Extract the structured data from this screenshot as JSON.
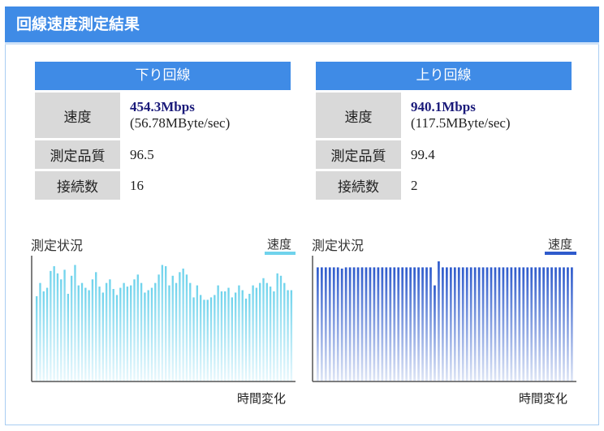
{
  "window": {
    "title": "回線速度測定結果"
  },
  "download": {
    "header": "下り回線",
    "speed_label": "速度",
    "speed_value": "454.3Mbps",
    "speed_bytes": "(56.78MByte/sec)",
    "quality_label": "測定品質",
    "quality_value": "96.5",
    "connections_label": "接続数",
    "connections_value": "16"
  },
  "upload": {
    "header": "上り回線",
    "speed_label": "速度",
    "speed_value": "940.1Mbps",
    "speed_bytes": "(117.5MByte/sec)",
    "quality_label": "測定品質",
    "quality_value": "99.4",
    "connections_label": "接続数",
    "connections_value": "2"
  },
  "chart_data": [
    {
      "type": "bar",
      "title": "測定状況",
      "legend": "速度",
      "xlabel": "時間変化",
      "color": "#6fd3ec",
      "fade_color": "#e9f8fd",
      "ylim": [
        0,
        1
      ],
      "values": [
        0.71,
        0.82,
        0.75,
        0.78,
        0.92,
        0.96,
        0.9,
        0.85,
        0.93,
        0.73,
        0.88,
        0.97,
        0.8,
        0.82,
        0.78,
        0.76,
        0.85,
        0.91,
        0.79,
        0.74,
        0.82,
        0.85,
        0.77,
        0.72,
        0.78,
        0.82,
        0.79,
        0.8,
        0.85,
        0.89,
        0.82,
        0.74,
        0.76,
        0.78,
        0.82,
        0.89,
        0.97,
        0.96,
        0.8,
        0.88,
        0.82,
        0.91,
        0.94,
        0.89,
        0.82,
        0.7,
        0.8,
        0.72,
        0.68,
        0.68,
        0.7,
        0.72,
        0.8,
        0.75,
        0.75,
        0.78,
        0.7,
        0.74,
        0.8,
        0.76,
        0.69,
        0.73,
        0.8,
        0.78,
        0.82,
        0.86,
        0.82,
        0.79,
        0.75,
        0.9,
        0.88,
        0.82,
        0.76,
        0.76
      ]
    },
    {
      "type": "bar",
      "title": "測定状況",
      "legend": "速度",
      "xlabel": "時間変化",
      "color": "#2e5bcc",
      "fade_color": "#dfe6f6",
      "ylim": [
        0,
        1
      ],
      "values": [
        0.95,
        0.95,
        0.95,
        0.95,
        0.95,
        0.95,
        0.94,
        0.95,
        0.95,
        0.95,
        0.95,
        0.95,
        0.95,
        0.95,
        0.95,
        0.95,
        0.95,
        0.95,
        0.95,
        0.95,
        0.95,
        0.95,
        0.95,
        0.95,
        0.95,
        0.95,
        0.95,
        0.95,
        0.95,
        0.8,
        1.0,
        0.95,
        0.95,
        0.95,
        0.95,
        0.95,
        0.95,
        0.95,
        0.95,
        0.95,
        0.95,
        0.95,
        0.95,
        0.95,
        0.95,
        0.95,
        0.95,
        0.95,
        0.95,
        0.95,
        0.95,
        0.95,
        0.95,
        0.95,
        0.95,
        0.95,
        0.95,
        0.95,
        0.95,
        0.95,
        0.95,
        0.95,
        0.95,
        0.95
      ]
    }
  ]
}
